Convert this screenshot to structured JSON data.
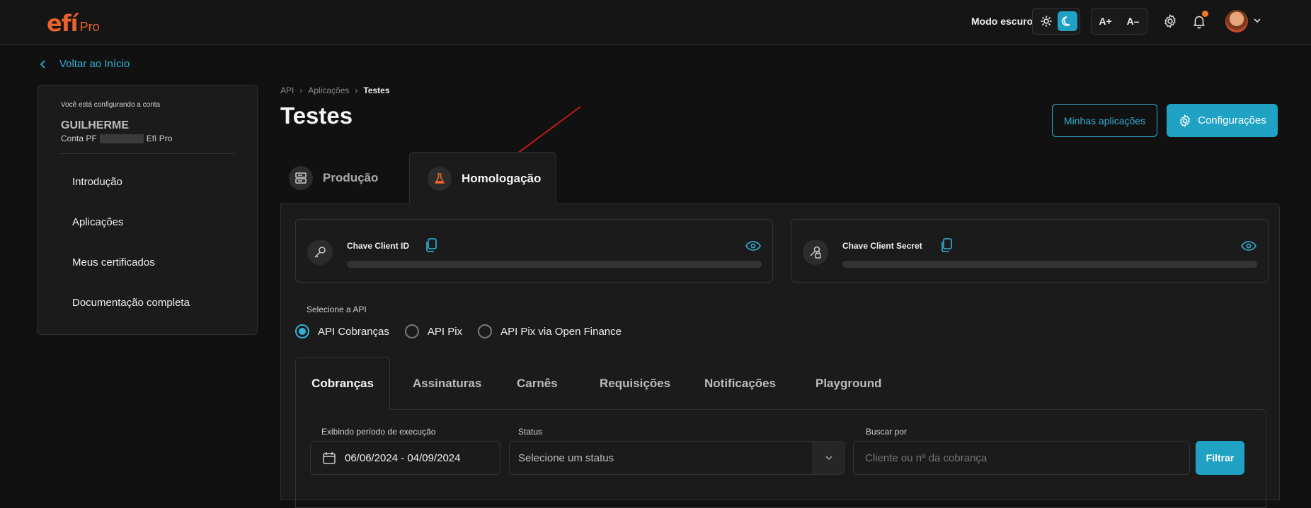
{
  "header": {
    "logo_text": "efí",
    "logo_suffix": "Pro",
    "dark_mode_label": "Modo escuro",
    "font_increase": "A+",
    "font_decrease": "A–",
    "accent_color": "#1fa2c4",
    "brand_color": "#e8622a"
  },
  "nav": {
    "back_label": "Voltar ao Início"
  },
  "sidebar": {
    "account_label": "Você está configurando a conta",
    "account_name": "GUILHERME",
    "account_type_prefix": "Conta PF",
    "account_type_suffix": "Efí Pro",
    "items": [
      {
        "label": "Introdução"
      },
      {
        "label": "Aplicações"
      },
      {
        "label": "Meus certificados"
      },
      {
        "label": "Documentação completa"
      }
    ]
  },
  "breadcrumb": {
    "items": [
      "API",
      "Aplicações"
    ],
    "current": "Testes"
  },
  "page": {
    "title": "Testes",
    "my_apps_button": "Minhas aplicações",
    "settings_button": "Configurações"
  },
  "env_tabs": [
    {
      "label": "Produção",
      "active": false,
      "icon": "server-icon"
    },
    {
      "label": "Homologação",
      "active": true,
      "icon": "flask-icon"
    }
  ],
  "keys": {
    "client_id_label": "Chave Client ID",
    "client_secret_label": "Chave Client Secret"
  },
  "api_select": {
    "label": "Selecione a API",
    "options": [
      {
        "label": "API Cobranças",
        "selected": true
      },
      {
        "label": "API Pix",
        "selected": false
      },
      {
        "label": "API Pix via Open Finance",
        "selected": false
      }
    ]
  },
  "sub_tabs": [
    "Cobranças",
    "Assinaturas",
    "Carnês",
    "Requisições",
    "Notificações",
    "Playground"
  ],
  "filters": {
    "period_label": "Exibindo período de execução",
    "period_value": "06/06/2024 - 04/09/2024",
    "status_label": "Status",
    "status_placeholder": "Selecione um status",
    "search_label": "Buscar por",
    "search_placeholder": "Cliente ou nº da cobrança",
    "filter_button": "Filtrar"
  }
}
